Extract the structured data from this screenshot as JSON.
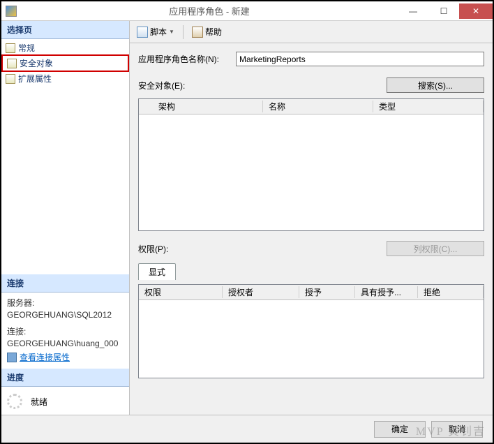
{
  "titlebar": {
    "title": "应用程序角色 - 新建"
  },
  "sidebar": {
    "select_header": "选择页",
    "items": [
      {
        "label": "常规"
      },
      {
        "label": "安全对象"
      },
      {
        "label": "扩展属性"
      }
    ],
    "connection_header": "连接",
    "server_label": "服务器:",
    "server_value": "GEORGEHUANG\\SQL2012",
    "conn_label": "连接:",
    "conn_value": "GEORGEHUANG\\huang_000",
    "view_conn_props": "查看连接属性",
    "progress_header": "进度",
    "progress_status": "就绪"
  },
  "toolbar": {
    "script": "脚本",
    "help": "帮助"
  },
  "form": {
    "role_name_label": "应用程序角色名称(N):",
    "role_name_value": "MarketingReports",
    "securables_label": "安全对象(E):",
    "search_btn": "搜索(S)..."
  },
  "grid": {
    "cols": [
      "架构",
      "名称",
      "类型"
    ]
  },
  "perm": {
    "label": "权限(P):",
    "col_perm_btn": "列权限(C)...",
    "tab": "显式",
    "cols": [
      "权限",
      "授权者",
      "授予",
      "具有授予...",
      "拒绝"
    ]
  },
  "footer": {
    "ok": "确定",
    "cancel": "取消"
  },
  "watermark": "MVP  黄钊吉"
}
